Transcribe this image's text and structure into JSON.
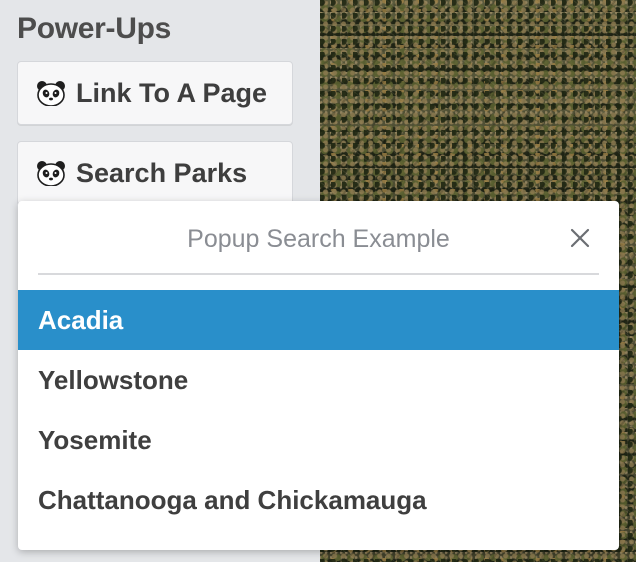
{
  "sidebar": {
    "title": "Power-Ups",
    "buttons": [
      {
        "label": "Link To A Page",
        "icon": "panda-icon"
      },
      {
        "label": "Search Parks",
        "icon": "panda-icon"
      }
    ]
  },
  "popup": {
    "title": "Popup Search Example",
    "close_icon": "close-icon",
    "items": [
      {
        "label": "Acadia",
        "selected": true
      },
      {
        "label": "Yellowstone",
        "selected": false
      },
      {
        "label": "Yosemite",
        "selected": false
      },
      {
        "label": "Chattanooga and Chickamauga",
        "selected": false
      }
    ]
  },
  "colors": {
    "selected_bg": "#298fca",
    "sidebar_bg": "#e4e6e9",
    "title_text": "#4d4d4d"
  }
}
